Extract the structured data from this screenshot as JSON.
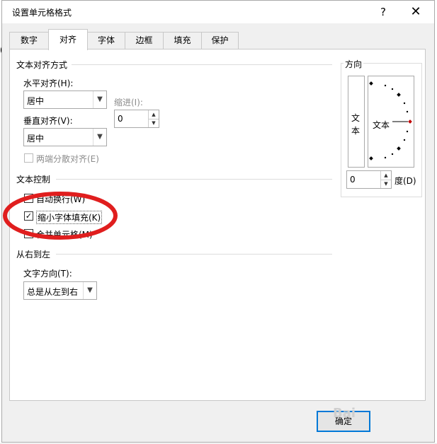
{
  "window": {
    "title": "设置单元格格式",
    "help_label": "?",
    "close_label": "✕"
  },
  "background": {
    "left_value": "0"
  },
  "tabs": [
    {
      "label": "数字"
    },
    {
      "label": "对齐"
    },
    {
      "label": "字体"
    },
    {
      "label": "边框"
    },
    {
      "label": "填充"
    },
    {
      "label": "保护"
    }
  ],
  "text_alignment": {
    "section_title": "文本对齐方式",
    "horizontal": {
      "label": "水平对齐(H):",
      "value": "居中"
    },
    "indent": {
      "label": "缩进(I):",
      "value": "0"
    },
    "vertical": {
      "label": "垂直对齐(V):",
      "value": "居中"
    },
    "justify_distributed": {
      "label": "两端分散对齐(E)",
      "checked": false,
      "enabled": false
    }
  },
  "text_control": {
    "section_title": "文本控制",
    "wrap_text": {
      "label": "自动换行(W)",
      "checked": false
    },
    "shrink_to_fit": {
      "label": "缩小字体填充(K)",
      "checked": true
    },
    "merge_cells": {
      "label": "合并单元格(M)",
      "checked": false
    }
  },
  "right_to_left": {
    "section_title": "从右到左",
    "direction": {
      "label": "文字方向(T):",
      "value": "总是从左到右"
    }
  },
  "orientation": {
    "section_title": "方向",
    "vertical_text_char1": "文",
    "vertical_text_char2": "本",
    "dial_text": "文本",
    "degrees_value": "0",
    "degrees_label": "度(D)"
  },
  "buttons": {
    "ok_label": "确定"
  },
  "watermark": {
    "text": "Bai"
  },
  "colors": {
    "accent": "#0078d7",
    "highlight": "#e01e1e",
    "dial_marker": "#c00000"
  }
}
